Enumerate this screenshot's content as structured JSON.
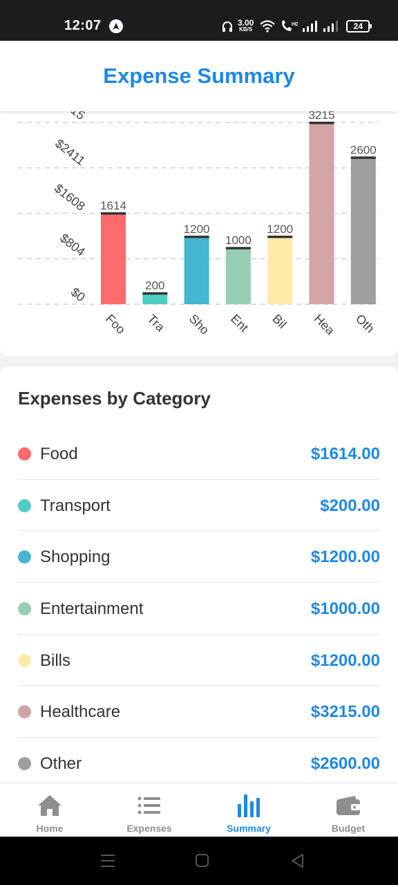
{
  "status_bar": {
    "time": "12:07",
    "net_speed_value": "3.00",
    "net_speed_unit": "KB/S",
    "battery": "24"
  },
  "header": {
    "title": "Expense Summary"
  },
  "chart_data": {
    "type": "bar",
    "categories": [
      "Foo",
      "Tra",
      "Sho",
      "Ent",
      "Bil",
      "Hea",
      "Oth"
    ],
    "values": [
      1614,
      200,
      1200,
      1000,
      1200,
      3215,
      2600
    ],
    "colors": [
      "#ff6b6b",
      "#4ecdc4",
      "#45b7d1",
      "#96ceb4",
      "#ffeaa7",
      "#d4a5a5",
      "#9e9e9e"
    ],
    "yticks": [
      "$0",
      "$804",
      "$1608",
      "$2411",
      "15"
    ],
    "ylim": [
      0,
      3215
    ],
    "grid": true,
    "gridlines": "dashed"
  },
  "categories_section": {
    "title": "Expenses by Category",
    "items": [
      {
        "name": "Food",
        "amount": "$1614.00",
        "color": "#ff6b6b"
      },
      {
        "name": "Transport",
        "amount": "$200.00",
        "color": "#4ecdc4"
      },
      {
        "name": "Shopping",
        "amount": "$1200.00",
        "color": "#45b7d1"
      },
      {
        "name": "Entertainment",
        "amount": "$1000.00",
        "color": "#96ceb4"
      },
      {
        "name": "Bills",
        "amount": "$1200.00",
        "color": "#ffeaa7"
      },
      {
        "name": "Healthcare",
        "amount": "$3215.00",
        "color": "#d4a5a5"
      },
      {
        "name": "Other",
        "amount": "$2600.00",
        "color": "#9e9e9e"
      }
    ]
  },
  "tabs": [
    {
      "label": "Home",
      "icon": "home-icon",
      "active": false
    },
    {
      "label": "Expenses",
      "icon": "list-icon",
      "active": false
    },
    {
      "label": "Summary",
      "icon": "bar-chart-icon",
      "active": true
    },
    {
      "label": "Budget",
      "icon": "wallet-icon",
      "active": false
    }
  ],
  "colors": {
    "accent": "#1e88e5",
    "inactive": "#8e8e8e"
  }
}
